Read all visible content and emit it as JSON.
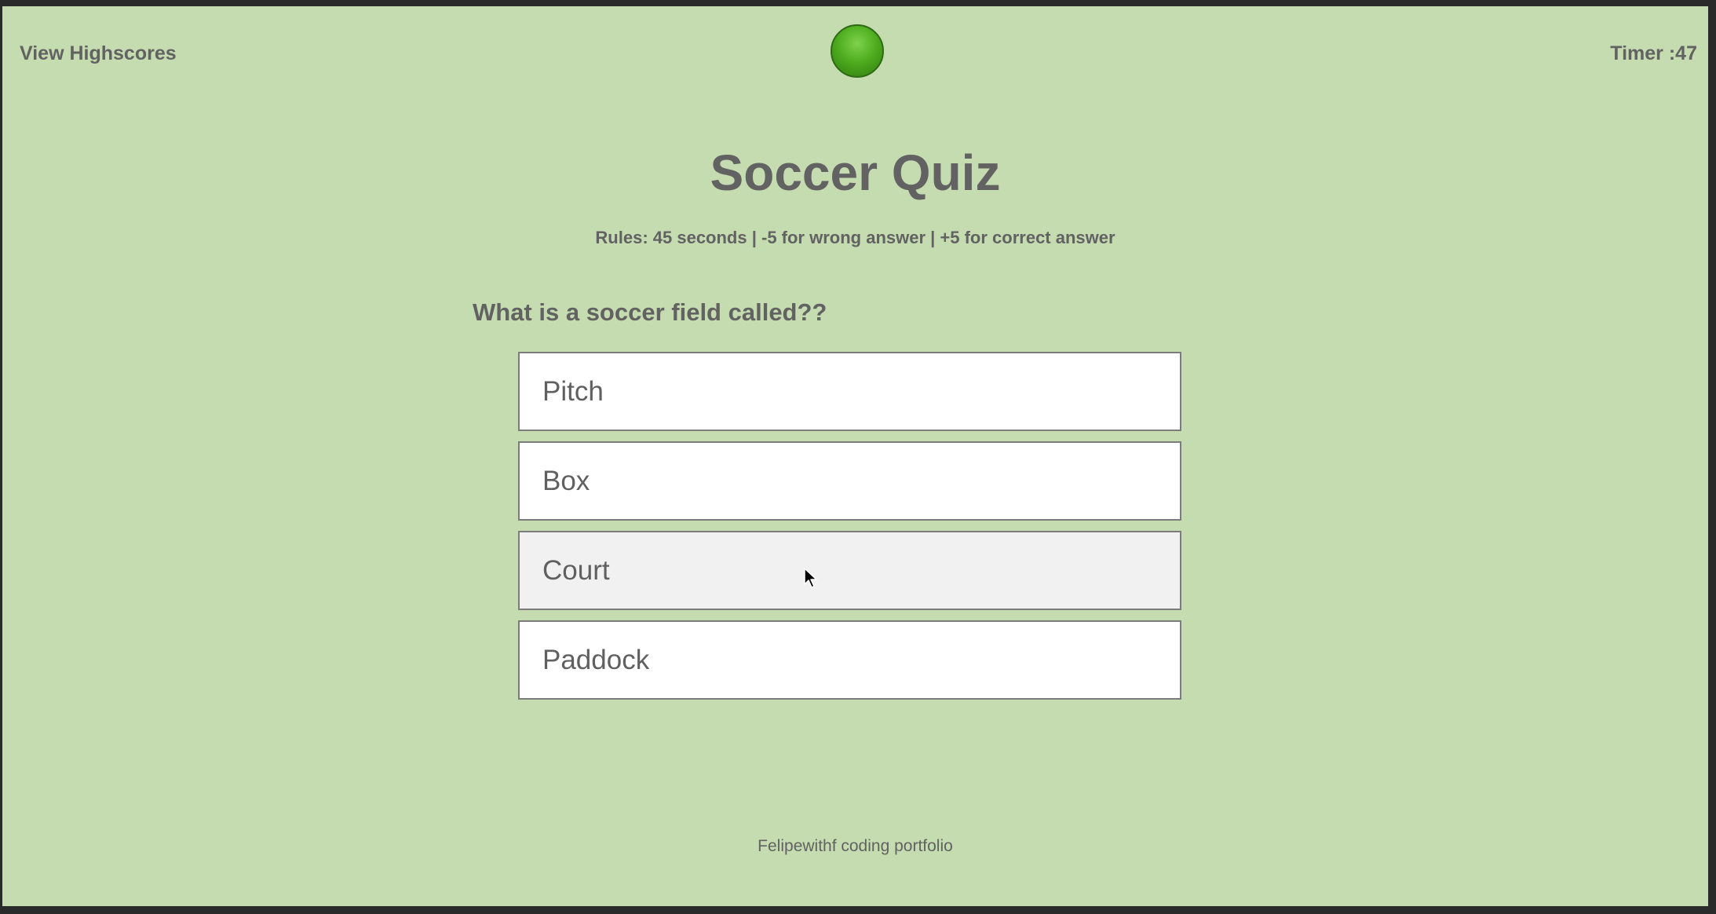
{
  "header": {
    "highscores_label": "View Highscores",
    "timer_text": "Timer :47"
  },
  "quiz": {
    "title": "Soccer Quiz",
    "rules": "Rules: 45 seconds | -5 for wrong answer | +5 for correct answer",
    "question": "What is a soccer field called??",
    "answers": [
      "Pitch",
      "Box",
      "Court",
      "Paddock"
    ],
    "hovered_answer": "Court"
  },
  "footer": {
    "text": "Felipewithf coding portfolio"
  },
  "colors": {
    "background": "#c5dcb0",
    "text": "#626262",
    "ball": "#4fae1f"
  },
  "icons": {
    "logo": "soccer-ball-icon",
    "pointer": "mouse-cursor-icon"
  }
}
